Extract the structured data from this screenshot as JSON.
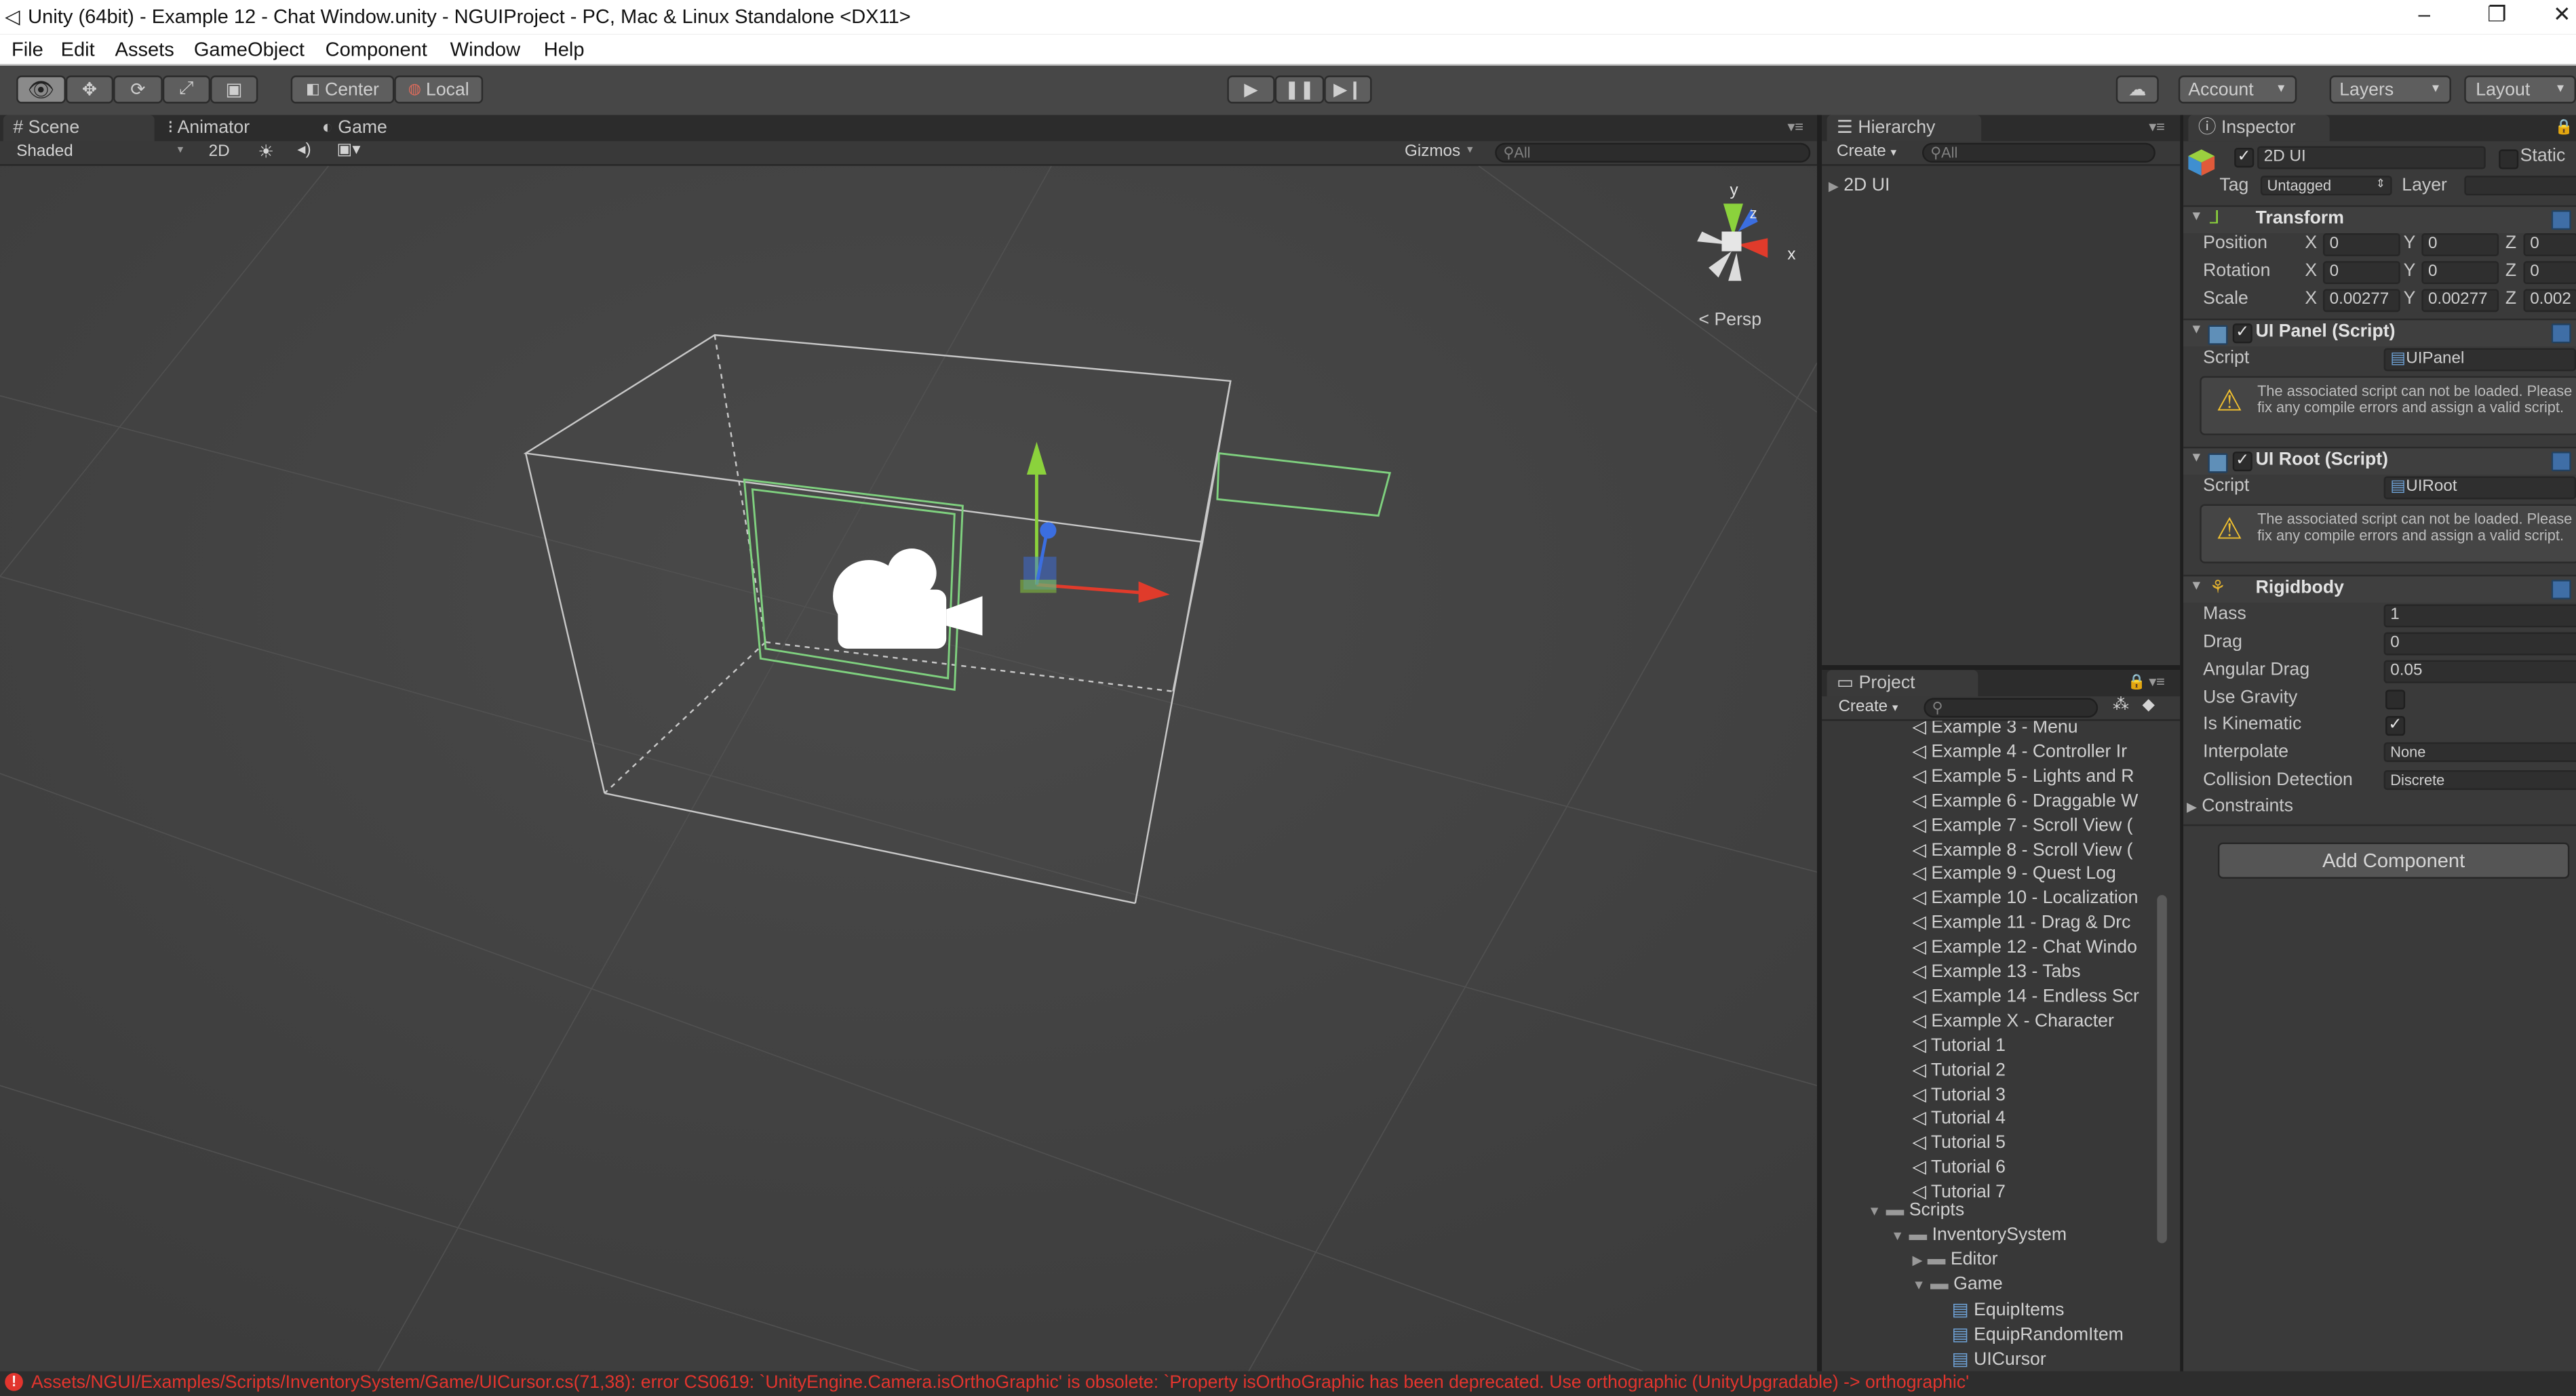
{
  "window": {
    "title": "Unity (64bit) - Example 12 - Chat Window.unity - NGUIProject - PC, Mac & Linux Standalone <DX11>",
    "controls": [
      "–",
      "❐",
      "✕"
    ]
  },
  "menu": [
    "File",
    "Edit",
    "Assets",
    "GameObject",
    "Component",
    "Window",
    "Help"
  ],
  "toolbar": {
    "pivot": "Center",
    "space": "Local",
    "account": "Account",
    "layers": "Layers",
    "layout": "Layout"
  },
  "scene_panel": {
    "tabs": [
      "Scene",
      "Animator",
      "Game"
    ],
    "shading": "Shaded",
    "mode_2d": "2D",
    "gizmos": "Gizmos",
    "search_placeholder": "All",
    "persp": "Persp",
    "axis_y": "y",
    "axis_x": "x",
    "axis_z": "z"
  },
  "hierarchy": {
    "tab": "Hierarchy",
    "create": "Create",
    "search_placeholder": "All",
    "items": [
      "2D UI"
    ]
  },
  "project": {
    "tab": "Project",
    "create": "Create",
    "items": [
      "Example 3 - Menu",
      "Example 4 - Controller Ir",
      "Example 5 - Lights and R",
      "Example 6 - Draggable W",
      "Example 7 - Scroll View (",
      "Example 8 - Scroll View (",
      "Example 9 - Quest Log",
      "Example 10 - Localization",
      "Example 11 - Drag & Drc",
      "Example 12 - Chat Windo",
      "Example 13 - Tabs",
      "Example 14 - Endless Scr",
      "Example X - Character",
      "Tutorial 1",
      "Tutorial 2",
      "Tutorial 3",
      "Tutorial 4",
      "Tutorial 5",
      "Tutorial 6",
      "Tutorial 7"
    ],
    "folders": {
      "scripts": "Scripts",
      "inventory": "InventorySystem",
      "editor": "Editor",
      "game": "Game"
    },
    "scripts": [
      "EquipItems",
      "EquipRandomItem",
      "UICursor"
    ]
  },
  "inspector": {
    "tab": "Inspector",
    "object_name": "2D UI",
    "static": "Static",
    "tag_label": "Tag",
    "tag": "Untagged",
    "layer_label": "Layer",
    "transform": {
      "title": "Transform",
      "position_label": "Position",
      "rotation_label": "Rotation",
      "scale_label": "Scale",
      "x": "X",
      "y": "Y",
      "z": "Z",
      "position": [
        "0",
        "0",
        "0"
      ],
      "rotation": [
        "0",
        "0",
        "0"
      ],
      "scale": [
        "0.00277",
        "0.00277",
        "0.002"
      ]
    },
    "ui_panel": {
      "title": "UI Panel (Script)",
      "script_label": "Script",
      "script": "UIPanel",
      "warning": "The associated script can not be loaded. Please fix any compile errors and assign a valid script."
    },
    "ui_root": {
      "title": "UI Root (Script)",
      "script_label": "Script",
      "script": "UIRoot",
      "warning": "The associated script can not be loaded. Please fix any compile errors and assign a valid script."
    },
    "rigidbody": {
      "title": "Rigidbody",
      "mass_label": "Mass",
      "mass": "1",
      "drag_label": "Drag",
      "drag": "0",
      "angular_drag_label": "Angular Drag",
      "angular_drag": "0.05",
      "use_gravity_label": "Use Gravity",
      "use_gravity": false,
      "is_kinematic_label": "Is Kinematic",
      "is_kinematic": true,
      "interpolate_label": "Interpolate",
      "interpolate": "None",
      "collision_label": "Collision Detection",
      "collision": "Discrete",
      "constraints_label": "Constraints"
    },
    "add_component": "Add Component"
  },
  "console": {
    "message": "Assets/NGUI/Examples/Scripts/InventorySystem/Game/UICursor.cs(71,38): error CS0619: `UnityEngine.Camera.isOrthoGraphic' is obsolete: `Property isOrthoGraphic has been deprecated. Use orthographic (UnityUpgradable) -> orthographic'"
  },
  "colors": {
    "accent_green": "#7fd17f",
    "axis_x": "#e03b2b",
    "axis_y": "#8bd23c",
    "axis_z": "#3b6ee0",
    "error": "#e2352e"
  }
}
